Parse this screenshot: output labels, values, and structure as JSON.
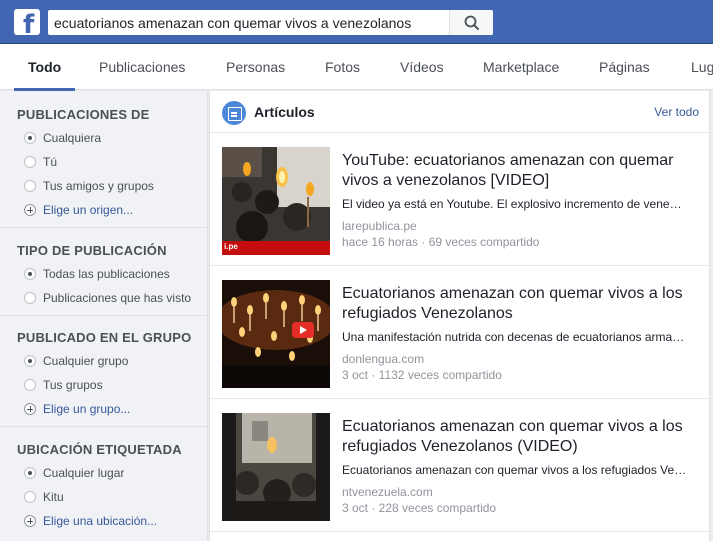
{
  "header": {
    "logo_letter": "f",
    "search_value": "ecuatorianos amenazan con quemar vivos a venezolanos"
  },
  "tabs": [
    {
      "label": "Todo"
    },
    {
      "label": "Publicaciones"
    },
    {
      "label": "Personas"
    },
    {
      "label": "Fotos"
    },
    {
      "label": "Vídeos"
    },
    {
      "label": "Marketplace"
    },
    {
      "label": "Páginas"
    },
    {
      "label": "Lug"
    }
  ],
  "filters": [
    {
      "title": "PUBLICACIONES DE",
      "options": [
        "Cualquiera",
        "Tú",
        "Tus amigos y grupos"
      ],
      "add_link": "Elige un origen..."
    },
    {
      "title": "TIPO DE PUBLICACIÓN",
      "options": [
        "Todas las publicaciones",
        "Publicaciones que has visto"
      ]
    },
    {
      "title": "PUBLICADO EN EL GRUPO",
      "options": [
        "Cualquier grupo",
        "Tus grupos"
      ],
      "add_link": "Elige un grupo..."
    },
    {
      "title": "UBICACIÓN ETIQUETADA",
      "options": [
        "Cualquier lugar",
        "Kitu"
      ],
      "add_link": "Elige una ubicación..."
    }
  ],
  "articles": {
    "title": "Artículos",
    "see_all": "Ver todo",
    "results": [
      {
        "title": "YouTube: ecuatorianos amenazan con quemar vivos a venezolanos [VIDEO]",
        "description": "El video ya está en Youtube. El explosivo incremento de venezolanos en Ecuador",
        "source": "larepublica.pe",
        "meta": "hace 16 horas · 69 veces compartido",
        "thumb_label": "i.pe"
      },
      {
        "title": "Ecuatorianos amenazan con quemar vivos a los refugiados Venezolanos",
        "description": "Una manifestación nutrida con decenas de ecuatorianos armados con antorchas",
        "source": "donlengua.com",
        "meta": "3 oct · 1132 veces compartido"
      },
      {
        "title": "Ecuatorianos amenazan con quemar vivos a los refugiados Venezolanos (VIDEO)",
        "description": "Ecuatorianos amenazan con quemar vivos a los refugiados Venezolanos (VIDEO)",
        "source": "ntvenezuela.com",
        "meta": "3 oct · 228 veces compartido"
      }
    ]
  },
  "colors": {
    "brand": "#4267b2",
    "link": "#365899",
    "sidebar_bg": "#f1f2f5"
  }
}
